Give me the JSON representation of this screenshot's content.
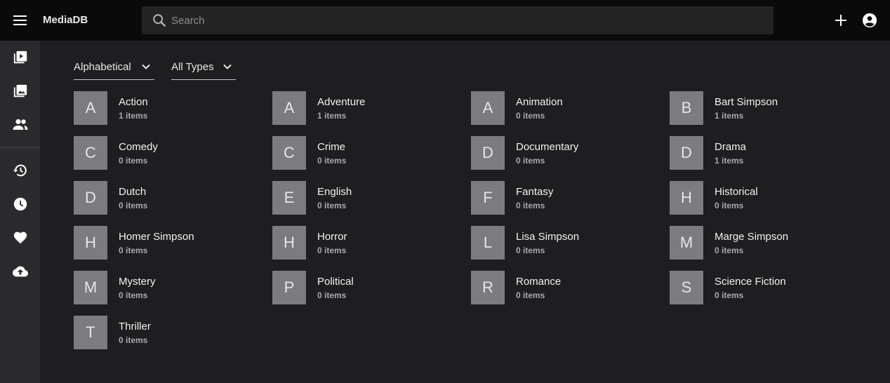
{
  "app": {
    "title": "MediaDB"
  },
  "search": {
    "placeholder": "Search"
  },
  "filters": {
    "sort": "Alphabetical",
    "type": "All Types"
  },
  "sidebar": {
    "items": [
      {
        "icon": "video-library-icon"
      },
      {
        "icon": "photo-library-icon"
      },
      {
        "icon": "people-icon"
      },
      {
        "icon": "history-icon"
      },
      {
        "icon": "clock-icon"
      },
      {
        "icon": "heart-icon"
      },
      {
        "icon": "cloud-upload-icon"
      }
    ]
  },
  "colors": {
    "topbar": "#0a0a0a",
    "sidebar": "#2a2a2d",
    "background": "#1e1e20",
    "tile": "#7b7b80"
  },
  "tags": [
    {
      "letter": "A",
      "name": "Action",
      "count": "1 items"
    },
    {
      "letter": "A",
      "name": "Adventure",
      "count": "1 items"
    },
    {
      "letter": "A",
      "name": "Animation",
      "count": "0 items"
    },
    {
      "letter": "B",
      "name": "Bart Simpson",
      "count": "1 items"
    },
    {
      "letter": "C",
      "name": "Comedy",
      "count": "0 items"
    },
    {
      "letter": "C",
      "name": "Crime",
      "count": "0 items"
    },
    {
      "letter": "D",
      "name": "Documentary",
      "count": "0 items"
    },
    {
      "letter": "D",
      "name": "Drama",
      "count": "1 items"
    },
    {
      "letter": "D",
      "name": "Dutch",
      "count": "0 items"
    },
    {
      "letter": "E",
      "name": "English",
      "count": "0 items"
    },
    {
      "letter": "F",
      "name": "Fantasy",
      "count": "0 items"
    },
    {
      "letter": "H",
      "name": "Historical",
      "count": "0 items"
    },
    {
      "letter": "H",
      "name": "Homer Simpson",
      "count": "0 items"
    },
    {
      "letter": "H",
      "name": "Horror",
      "count": "0 items"
    },
    {
      "letter": "L",
      "name": "Lisa Simpson",
      "count": "0 items"
    },
    {
      "letter": "M",
      "name": "Marge Simpson",
      "count": "0 items"
    },
    {
      "letter": "M",
      "name": "Mystery",
      "count": "0 items"
    },
    {
      "letter": "P",
      "name": "Political",
      "count": "0 items"
    },
    {
      "letter": "R",
      "name": "Romance",
      "count": "0 items"
    },
    {
      "letter": "S",
      "name": "Science Fiction",
      "count": "0 items"
    },
    {
      "letter": "T",
      "name": "Thriller",
      "count": "0 items"
    }
  ]
}
